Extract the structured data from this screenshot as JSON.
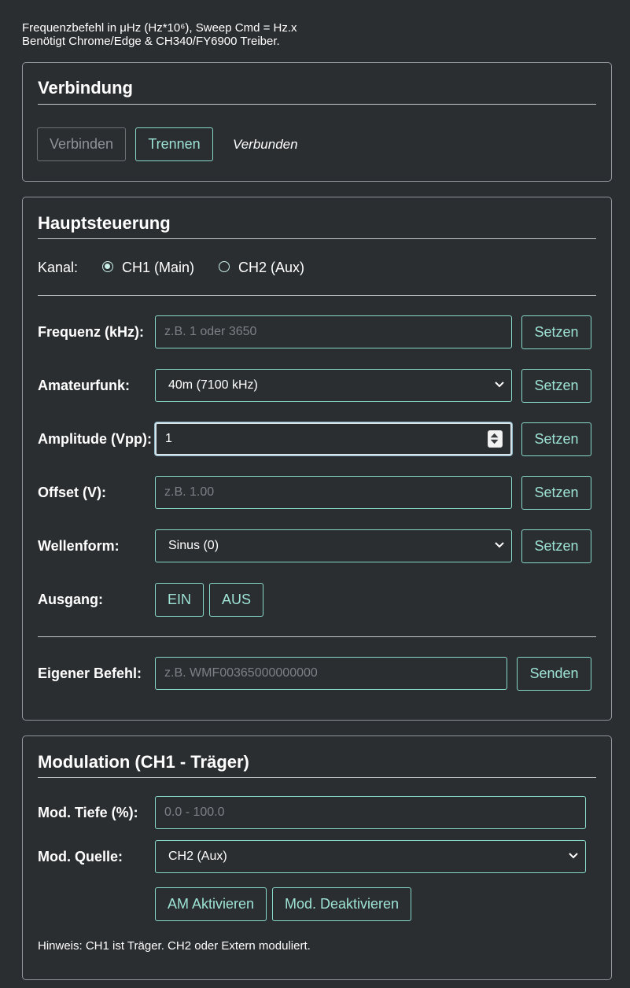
{
  "intro": {
    "line1": "Frequenzbefehl in μHz (Hz*10⁶), Sweep Cmd = Hz.x",
    "line2": "Benötigt Chrome/Edge & CH340/FY6900 Treiber."
  },
  "connection": {
    "title": "Verbindung",
    "connect_label": "Verbinden",
    "disconnect_label": "Trennen",
    "status": "Verbunden"
  },
  "main": {
    "title": "Hauptsteuerung",
    "channel_label": "Kanal:",
    "ch1_label": "CH1 (Main)",
    "ch2_label": "CH2 (Aux)",
    "selected_channel": "CH1 (Main)",
    "frequency": {
      "label": "Frequenz (kHz):",
      "placeholder": "z.B. 1 oder 3650",
      "value": "",
      "button": "Setzen"
    },
    "ham": {
      "label": "Amateurfunk:",
      "value": "40m (7100 kHz)",
      "button": "Setzen"
    },
    "amplitude": {
      "label": "Amplitude (Vpp):",
      "value": "1",
      "button": "Setzen"
    },
    "offset": {
      "label": "Offset (V):",
      "placeholder": "z.B. 1.00",
      "value": "",
      "button": "Setzen"
    },
    "waveform": {
      "label": "Wellenform:",
      "value": "Sinus (0)",
      "button": "Setzen"
    },
    "output": {
      "label": "Ausgang:",
      "on_label": "EIN",
      "off_label": "AUS"
    },
    "custom": {
      "label": "Eigener Befehl:",
      "placeholder": "z.B. WMF00365000000000",
      "value": "",
      "button": "Senden"
    }
  },
  "modulation": {
    "title": "Modulation (CH1 - Träger)",
    "depth": {
      "label": "Mod. Tiefe (%):",
      "placeholder": "0.0 - 100.0",
      "value": ""
    },
    "source": {
      "label": "Mod. Quelle:",
      "value": "CH2 (Aux)"
    },
    "am_enable_label": "AM Aktivieren",
    "disable_label": "Mod. Deaktivieren",
    "hint": "Hinweis: CH1 ist Träger. CH2 oder Extern moduliert."
  },
  "colors": {
    "background": "#2b2e31",
    "accent": "#87d9cc",
    "accent_text": "#9de3d6",
    "border": "#8f969c"
  }
}
